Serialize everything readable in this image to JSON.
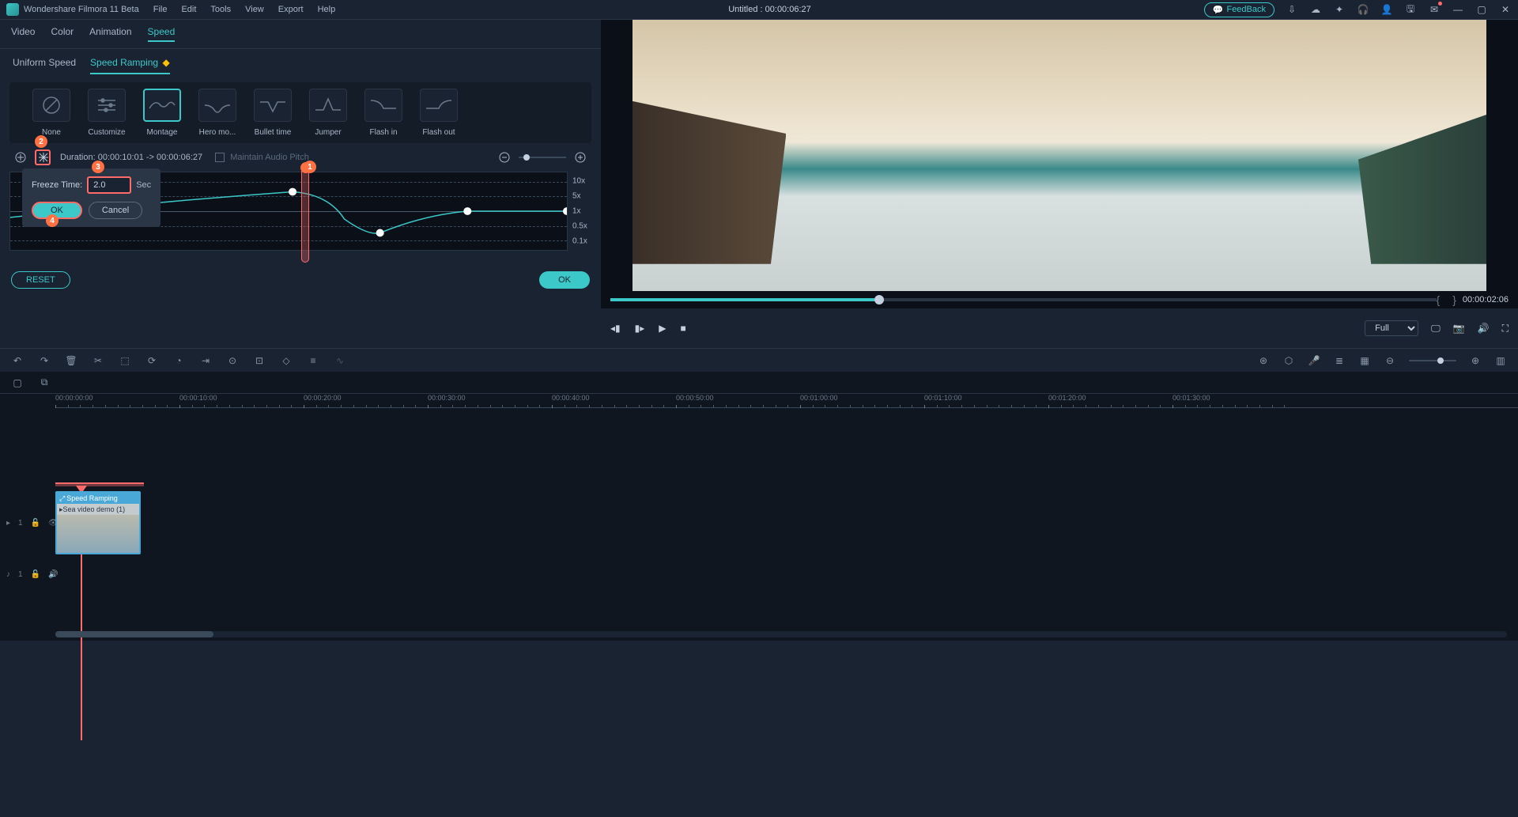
{
  "app": {
    "title": "Wondershare Filmora 11 Beta",
    "document": "Untitled : 00:00:06:27",
    "feedback": "FeedBack"
  },
  "top_menu": [
    "File",
    "Edit",
    "Tools",
    "View",
    "Export",
    "Help"
  ],
  "mode_tabs": [
    "Video",
    "Color",
    "Animation",
    "Speed"
  ],
  "mode_active": "Speed",
  "sub_tabs": {
    "uniform": "Uniform Speed",
    "ramping": "Speed Ramping"
  },
  "sub_active": "Speed Ramping",
  "presets": [
    {
      "label": "None"
    },
    {
      "label": "Customize"
    },
    {
      "label": "Montage"
    },
    {
      "label": "Hero mo..."
    },
    {
      "label": "Bullet time"
    },
    {
      "label": "Jumper"
    },
    {
      "label": "Flash in"
    },
    {
      "label": "Flash out"
    }
  ],
  "preset_active": "Montage",
  "ramp": {
    "duration_label": "Duration:",
    "duration_value": "00:00:10:01 -> 00:00:06:27",
    "pitch": "Maintain Audio Pitch",
    "speed_marks": [
      "10x",
      "5x",
      "1x",
      "0.5x",
      "0.1x"
    ]
  },
  "freeze_popup": {
    "label": "Freeze Time:",
    "value": "2.0",
    "unit": "Sec",
    "ok": "OK",
    "cancel": "Cancel"
  },
  "callouts": {
    "c1": "1",
    "c2": "2",
    "c3": "3",
    "c4": "4"
  },
  "panel_buttons": {
    "reset": "RESET",
    "ok": "OK"
  },
  "preview": {
    "time": "00:00:02:06",
    "full": "Full"
  },
  "ruler": [
    "00:00:00:00",
    "00:00:10:00",
    "00:00:20:00",
    "00:00:30:00",
    "00:00:40:00",
    "00:00:50:00",
    "00:01:00:00",
    "00:01:10:00",
    "00:01:20:00",
    "00:01:30:00"
  ],
  "clip": {
    "fx": "Speed Ramping",
    "name": "Sea video demo (1)"
  },
  "track_labels": {
    "video": "1",
    "audio": "1"
  }
}
